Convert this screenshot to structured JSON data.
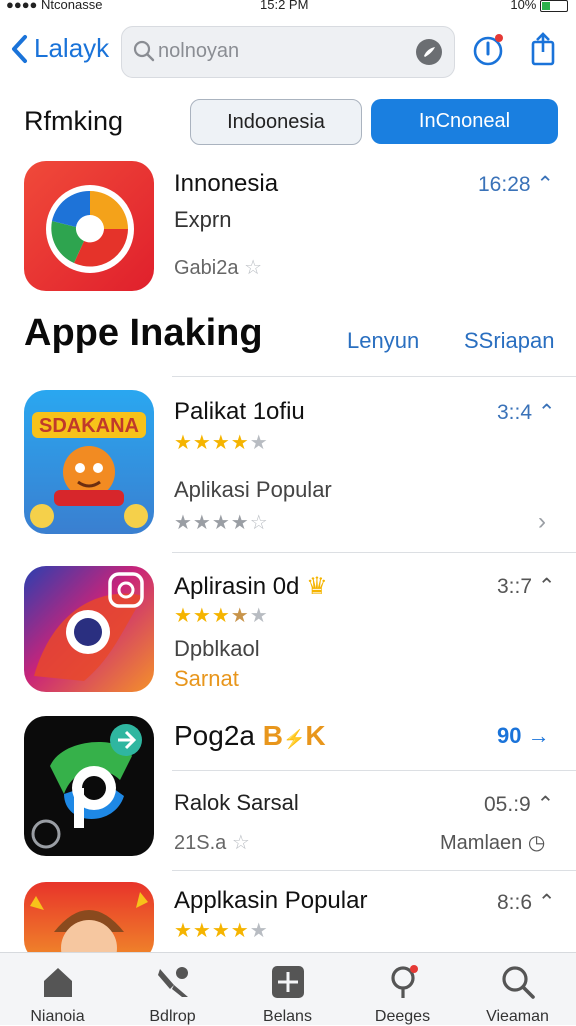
{
  "status": {
    "carrier": "Ntconasse",
    "time": "15:2 PM",
    "battery": "10%"
  },
  "nav": {
    "back_label": "Lalayk",
    "search_placeholder": "nolnoyan"
  },
  "ranking": {
    "title": "Rfmking",
    "segment_a": "Indoonesia",
    "segment_b": "InCnoneal"
  },
  "featured": {
    "name": "Innonesia",
    "subtitle": "Exprn",
    "rating_text": "Gabi2a",
    "time": "16:28"
  },
  "section": {
    "title": "Appe Inaking",
    "link_a": "Lenyun",
    "link_b": "SSriapan"
  },
  "apps": [
    {
      "name": "Palikat 1ofiu",
      "time": "3::4",
      "subtitle": "Aplikasi Popular"
    },
    {
      "name": "Aplirasin 0d",
      "time": "3::7",
      "subtitle": "Dpblkaol",
      "tag": "Sarnat"
    },
    {
      "name": "Pog2a",
      "badge": "B",
      "badge2": "K",
      "time": "90",
      "sub_name": "Ralok Sarsal",
      "sub_time": "05.:9",
      "rating_text": "21S.a",
      "action": "Mamlaen"
    },
    {
      "name": "Applkasin Popular",
      "time": "8::6"
    }
  ],
  "tabs": [
    {
      "label": "Nianoia",
      "icon": "home-icon"
    },
    {
      "label": "Bdlrop",
      "icon": "tools-icon"
    },
    {
      "label": "Belans",
      "icon": "plus-box-icon"
    },
    {
      "label": "Deeges",
      "icon": "person-search-icon"
    },
    {
      "label": "Vieaman",
      "icon": "search-icon"
    }
  ],
  "colors": {
    "accent": "#1a7fe0",
    "star": "#f5b400",
    "link": "#2a6fc0"
  }
}
